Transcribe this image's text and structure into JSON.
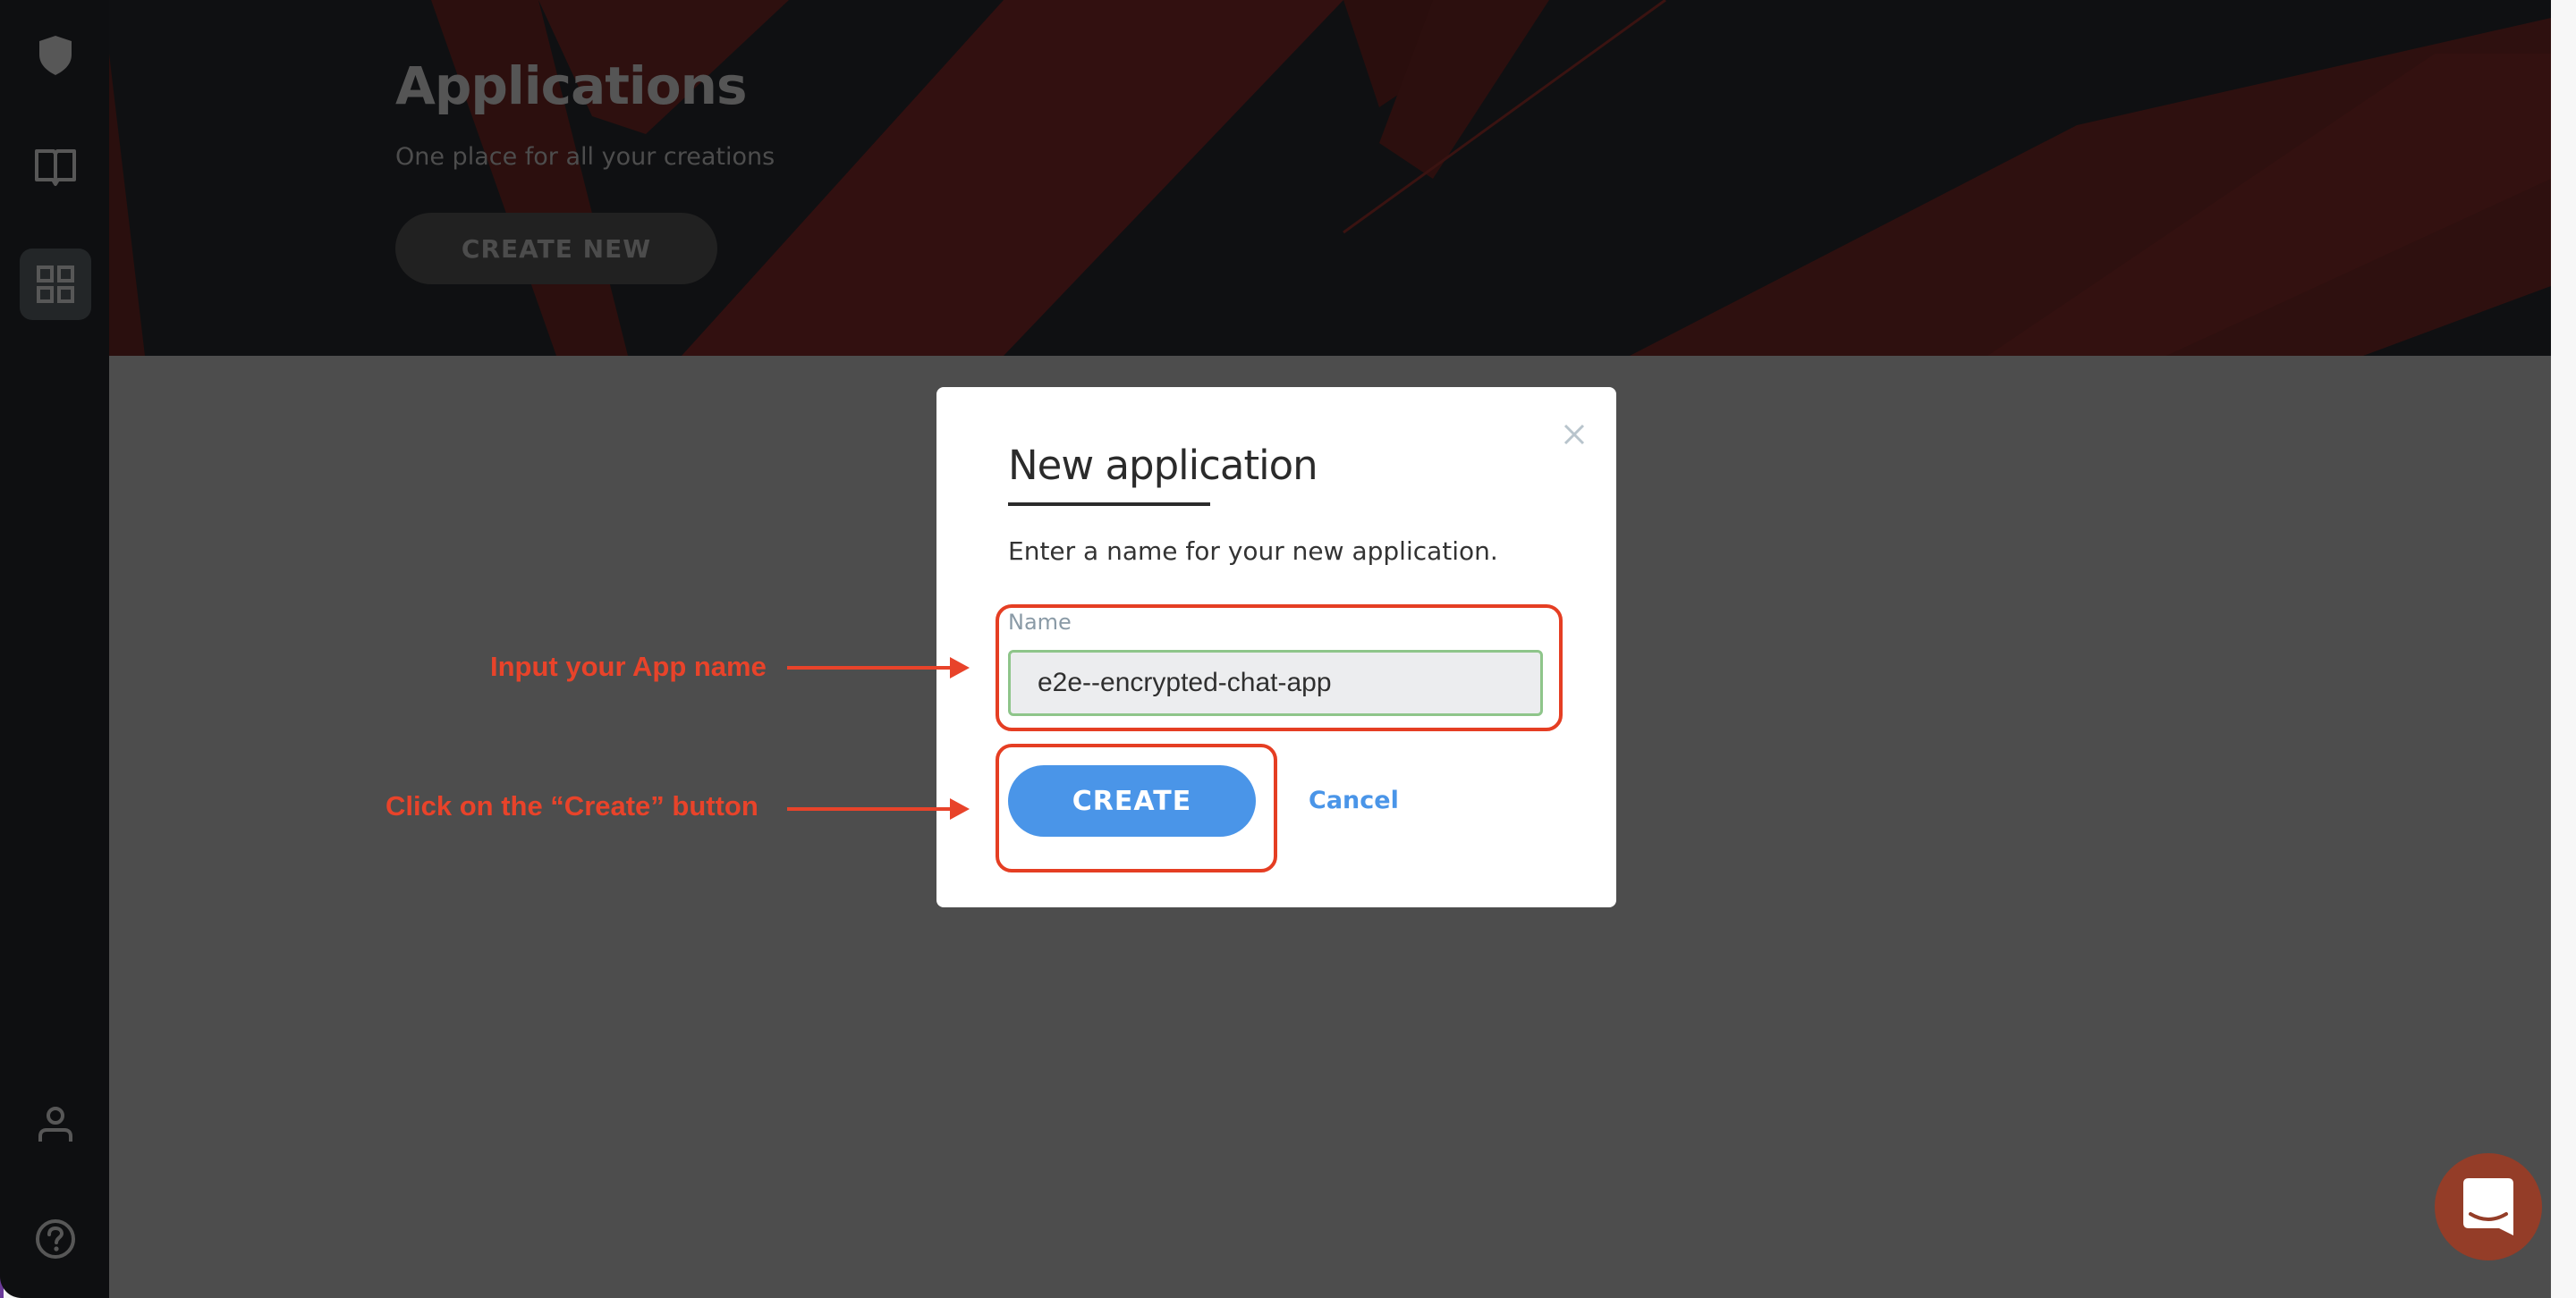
{
  "sidebar": {
    "items": [
      {
        "icon": "shield-icon",
        "active": false
      },
      {
        "icon": "book-icon",
        "active": false
      },
      {
        "icon": "grid-icon",
        "active": true
      },
      {
        "icon": "user-icon",
        "active": false
      },
      {
        "icon": "help-icon",
        "active": false
      }
    ]
  },
  "header": {
    "title": "Applications",
    "subtitle": "One place for all your creations",
    "create_new_label": "CREATE NEW"
  },
  "modal": {
    "title": "New application",
    "description": "Enter a name for your new application.",
    "name_label": "Name",
    "name_value": "e2e--encrypted-chat-app",
    "create_label": "CREATE",
    "cancel_label": "Cancel",
    "close_icon": "close-icon"
  },
  "annotations": {
    "input_hint": "Input your App name",
    "create_hint": "Click on the “Create” button"
  },
  "chat_widget": {
    "icon": "chat-bubble-icon"
  },
  "colors": {
    "accent_blue": "#4a95e8",
    "annotation_red": "#e8432a",
    "input_border_green": "#8ec58a",
    "chat_widget": "#943d28"
  }
}
